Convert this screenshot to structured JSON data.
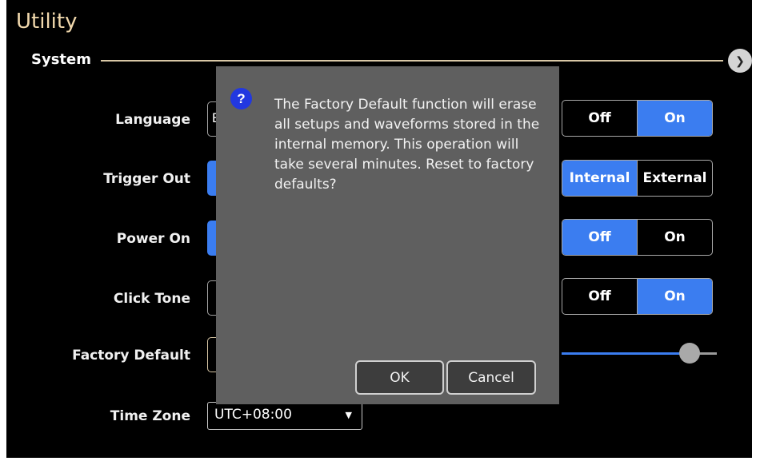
{
  "window": {
    "title": "Utility"
  },
  "section": {
    "label": "System",
    "collapse_icon": "chevron-down-icon"
  },
  "settings": {
    "language": {
      "label": "Language",
      "value_partial": "E"
    },
    "trigger_out": {
      "label": "Trigger Out"
    },
    "power_on": {
      "label": "Power On"
    },
    "click_tone": {
      "label": "Click Tone"
    },
    "factory_default": {
      "label": "Factory Default"
    },
    "time_zone": {
      "label": "Time Zone",
      "value": "UTC+08:00"
    }
  },
  "toggles": {
    "row1": {
      "options": [
        "Off",
        "On"
      ],
      "selected": "On"
    },
    "row2": {
      "options": [
        "Internal",
        "External"
      ],
      "selected": "Internal"
    },
    "row3": {
      "options": [
        "Off",
        "On"
      ],
      "selected": "Off"
    },
    "row4": {
      "options": [
        "Off",
        "On"
      ],
      "selected": "On"
    }
  },
  "slider": {
    "level": 0.87
  },
  "dialog": {
    "icon": "question-icon",
    "icon_glyph": "?",
    "message": "The Factory Default function will erase all setups and waveforms stored in the internal memory. This operation will take several minutes. Reset to factory defaults?",
    "ok_label": "OK",
    "cancel_label": "Cancel"
  },
  "colors": {
    "accent": "#3b7df0",
    "title": "#f2d9ad",
    "dialog_bg": "#5f5f5f",
    "question_icon": "#2238e0"
  }
}
